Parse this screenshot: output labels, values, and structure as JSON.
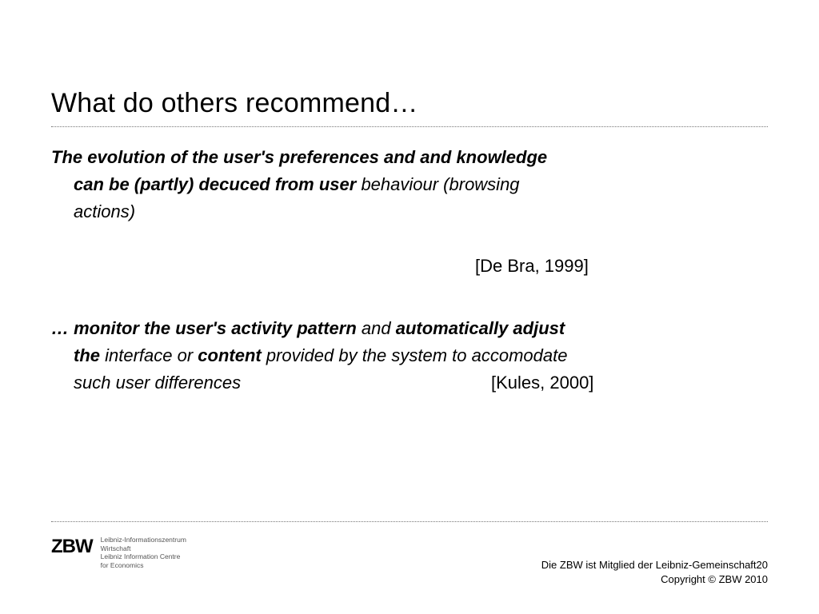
{
  "title": "What do others recommend…",
  "para1": {
    "l1a": "The evolution of the user's preferences and and knowledge",
    "l2a": "can be (partly) decuced from user ",
    "l2b": "behaviour (browsing",
    "l3a": "actions)"
  },
  "cite1": "[De Bra, 1999]",
  "para2": {
    "l1a": "… monitor the user's activity pattern",
    "l1b": " and ",
    "l1c": "automatically adjust",
    "l2a": "the",
    "l2b": " interface or ",
    "l2c": "content",
    "l2d": " provided by the system to accomodate",
    "l3a": "such user differences"
  },
  "cite2": "[Kules, 2000]",
  "logo": {
    "text": "ZBW",
    "sub1": "Leibniz-Informationszentrum",
    "sub2": "Wirtschaft",
    "sub3": "Leibniz Information Centre",
    "sub4": "for Economics"
  },
  "footer": {
    "line1": "Die ZBW ist Mitglied der Leibniz-Gemeinschaft",
    "line2": "Copyright © ZBW 2010"
  },
  "page": "20"
}
